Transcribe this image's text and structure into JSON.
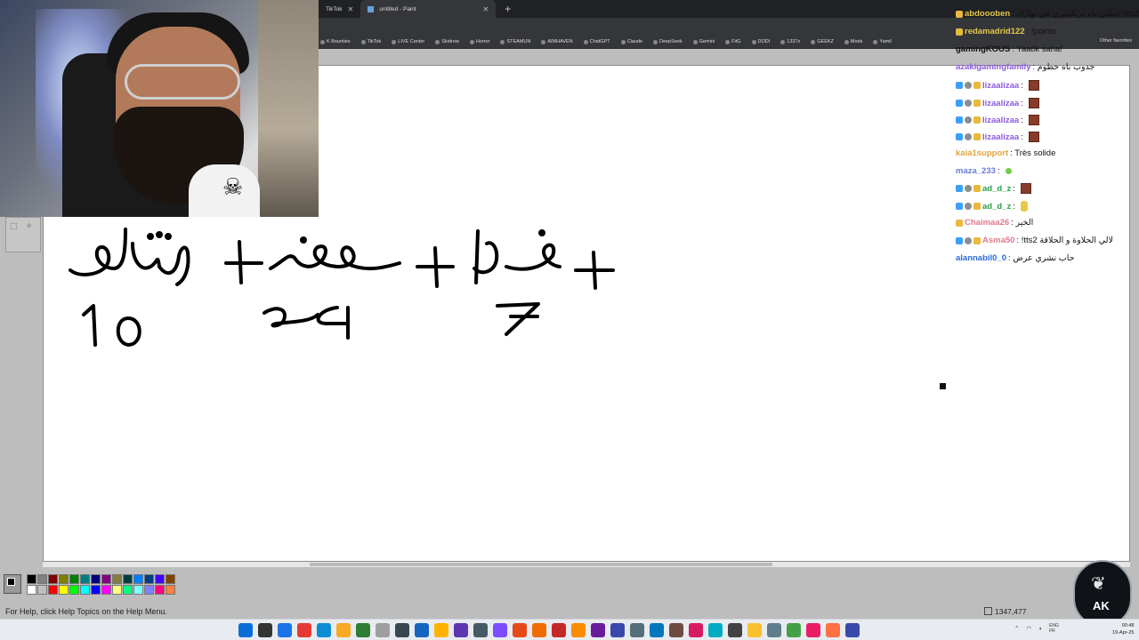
{
  "browser": {
    "tabs": [
      {
        "label": "TikTok"
      },
      {
        "label": "untitled - Paint",
        "active": true
      }
    ],
    "new_tab_label": "+",
    "bookmarks": [
      "K Bounties",
      "TikTok",
      "LIVE Center",
      "Skidrow",
      "Horror",
      "STEAMUN",
      "AIMHAVEN",
      "ChatGPT",
      "Claude",
      "DeepSeek",
      "Gemini",
      "FitG",
      "DODI",
      "1337x",
      "GEEKZ",
      "Mods",
      "Yamil"
    ],
    "other_favorites": "Other favorites"
  },
  "paint": {
    "status_help": "For Help, click Help Topics on the Help Menu.",
    "cursor_coords": "1347,477",
    "palette": [
      "#000000",
      "#808080",
      "#800000",
      "#808000",
      "#008000",
      "#008080",
      "#000080",
      "#800080",
      "#808040",
      "#004040",
      "#0080ff",
      "#004080",
      "#4000ff",
      "#804000",
      "#ffffff",
      "#c0c0c0",
      "#ff0000",
      "#ffff00",
      "#00ff00",
      "#00ffff",
      "#0000ff",
      "#ff00ff",
      "#ffff80",
      "#00ff80",
      "#80ffff",
      "#8080ff",
      "#ff0080",
      "#ff8040"
    ],
    "drawing": {
      "words": [
        "شرط",
        "+",
        "مخروط",
        "+",
        "خضرا",
        "+"
      ],
      "numbers": [
        "10",
        "24",
        "7"
      ]
    }
  },
  "chat": {
    "messages": [
      {
        "user": "abdoooben",
        "text": ": عطني باه تريكيبيري في نهارك !tts2",
        "user_color": "#e2c84a",
        "badges": 1
      },
      {
        "user": "redamadrid122",
        "text": ": !points",
        "user_color": "#e2c84a",
        "badges": 1
      },
      {
        "user": "gamingKOUS",
        "text": ": Yaatik saha!",
        "user_color": "#111111",
        "badges": 0
      },
      {
        "user": "azakigamingfamily",
        "text": ": جدوب باه حطوم",
        "user_color": "#8a5adf",
        "badges": 0
      },
      {
        "user": "lizaalizaa",
        "text": ":",
        "user_color": "#8a5adf",
        "badges": 3,
        "emote": "red"
      },
      {
        "user": "lizaalizaa",
        "text": ":",
        "user_color": "#8a5adf",
        "badges": 3,
        "emote": "red"
      },
      {
        "user": "lizaalizaa",
        "text": ":",
        "user_color": "#8a5adf",
        "badges": 3,
        "emote": "red"
      },
      {
        "user": "lizaalizaa",
        "text": ":",
        "user_color": "#8a5adf",
        "badges": 3,
        "emote": "red"
      },
      {
        "user": "kaia1support",
        "text": ": Très solide",
        "user_color": "#e2a43a",
        "badges": 0
      },
      {
        "user": "maza_233",
        "text": ":",
        "user_color": "#6a7adf",
        "badges": 0,
        "emote": "green"
      },
      {
        "user": "ad_d_z",
        "text": ":",
        "user_color": "#2aa04a",
        "badges": 3,
        "emote": "red"
      },
      {
        "user": "ad_d_z",
        "text": ":",
        "user_color": "#2aa04a",
        "badges": 3,
        "emote": "yellow"
      },
      {
        "user": "Chaimaa26",
        "text": ": الخير",
        "user_color": "#e07a8a",
        "badges": 1
      },
      {
        "user": "Asma50",
        "text": ": !tts2 لالي الحلاوة و الحلاقة",
        "user_color": "#e07a8a",
        "badges": 3
      },
      {
        "user": "alannabil0_0",
        "text": ": حاب نشري عرض",
        "user_color": "#2a6adf",
        "badges": 0
      }
    ]
  },
  "overlay_logo": {
    "text": "AK"
  },
  "taskbar": {
    "tray_lang": "ENG\nFR",
    "time": "00:48",
    "date": "19-Apr-25"
  }
}
